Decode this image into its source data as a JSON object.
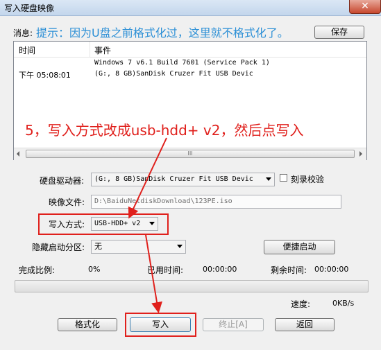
{
  "window": {
    "title": "写入硬盘映像",
    "close_symbol": "✕"
  },
  "message": {
    "label": "消息:",
    "hint": "提示：因为U盘之前格式化过，这里就不格式化了。",
    "save_button": "保存"
  },
  "log": {
    "headers": [
      "时间",
      "事件"
    ],
    "rows": [
      {
        "time": "",
        "event": "Windows 7 v6.1 Build 7601 (Service Pack 1)"
      },
      {
        "time": "下午 05:08:01",
        "event": "(G:, 8 GB)SanDisk Cruzer Fit USB Devic"
      }
    ],
    "scroll_grip": "III"
  },
  "annotation": {
    "text": "5，写入方式改成usb-hdd+ v2，然后点写入",
    "color": "#e0201c"
  },
  "form": {
    "drive_label": "硬盘驱动器:",
    "drive_value": "(G:, 8 GB)SanDisk Cruzer Fit USB Devic",
    "verify_label": "刻录校验",
    "image_label": "映像文件:",
    "image_value": "D:\\BaiduNetdiskDownload\\123PE.iso",
    "write_mode_label": "写入方式:",
    "write_mode_value": "USB-HDD+ v2",
    "hidden_label": "隐藏启动分区:",
    "hidden_value": "无",
    "quick_start_button": "便捷启动"
  },
  "progress": {
    "complete_label": "完成比例:",
    "complete_value": "0%",
    "percent": 0,
    "elapsed_label": "已用时间:",
    "elapsed_value": "00:00:00",
    "remaining_label": "剩余时间:",
    "remaining_value": "00:00:00",
    "speed_label": "速度:",
    "speed_value": "0KB/s"
  },
  "buttons": {
    "format": "格式化",
    "write": "写入",
    "abort": "终止[A]",
    "back": "返回"
  }
}
